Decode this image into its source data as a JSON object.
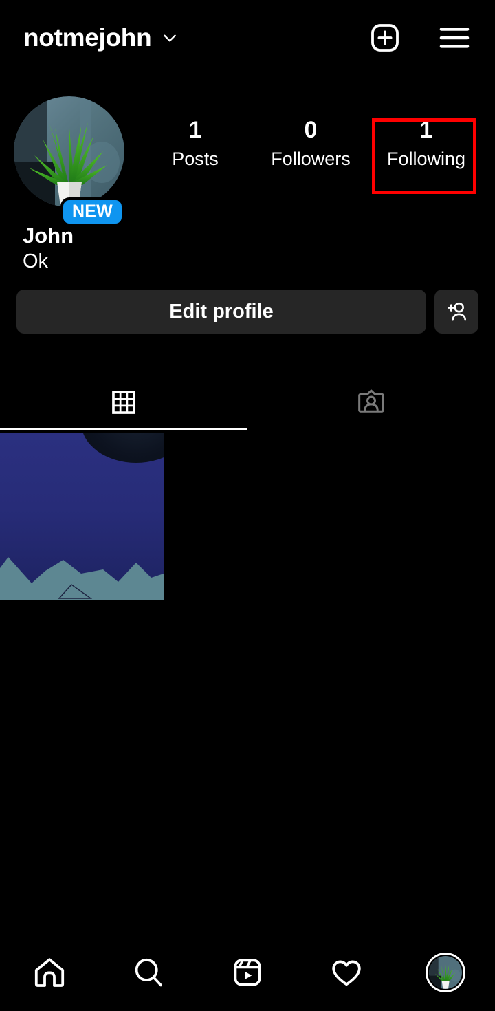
{
  "header": {
    "username": "notmejohn",
    "chevron_icon": "chevron-down-icon",
    "create_icon": "plus-square-icon",
    "menu_icon": "hamburger-menu-icon"
  },
  "profile": {
    "avatar_icon": "profile-avatar-plant-photo",
    "new_badge": "NEW",
    "name": "John",
    "bio": "Ok",
    "stats": [
      {
        "value": "1",
        "label": "Posts"
      },
      {
        "value": "0",
        "label": "Followers"
      },
      {
        "value": "1",
        "label": "Following"
      }
    ]
  },
  "annotation": {
    "target": "Following",
    "color": "#ff0000"
  },
  "actions": {
    "edit_profile_label": "Edit profile",
    "add_person_icon": "add-person-icon"
  },
  "tabs": [
    {
      "name": "grid",
      "icon": "grid-icon",
      "active": true
    },
    {
      "name": "tagged",
      "icon": "tagged-person-icon",
      "active": false
    }
  ],
  "grid": {
    "posts": [
      {
        "icon": "post-thumbnail-mountains-night"
      }
    ]
  },
  "bottom_nav": [
    {
      "name": "home",
      "icon": "home-icon"
    },
    {
      "name": "search",
      "icon": "search-icon"
    },
    {
      "name": "reels",
      "icon": "reels-icon"
    },
    {
      "name": "activity",
      "icon": "heart-icon"
    },
    {
      "name": "profile",
      "icon": "profile-avatar-icon"
    }
  ],
  "colors": {
    "background": "#000000",
    "button_surface": "#262626",
    "badge_blue": "#0f95f0",
    "annotation_red": "#ff0000",
    "text_primary": "#ffffff",
    "tab_inactive": "#7a7a7a"
  }
}
